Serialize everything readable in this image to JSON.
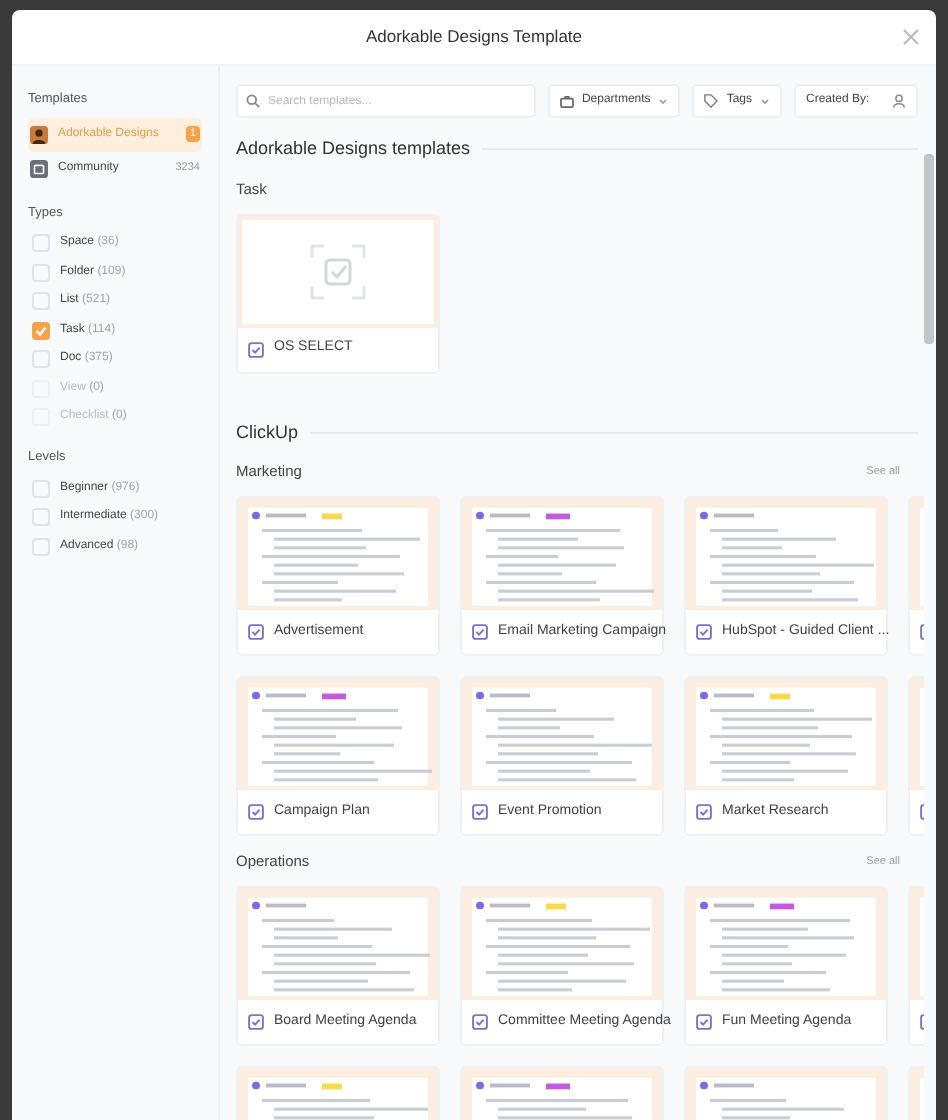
{
  "window": {
    "title": "Adorkable Designs Template"
  },
  "sidebar": {
    "templates_heading": "Templates",
    "sources": [
      {
        "label": "Adorkable Designs",
        "count": "1",
        "selected": true,
        "kind": "avatar"
      },
      {
        "label": "Community",
        "count": "3234",
        "selected": false,
        "kind": "store"
      }
    ],
    "types_heading": "Types",
    "types": [
      {
        "label": "Space",
        "count": "(36)",
        "checked": false,
        "disabled": false
      },
      {
        "label": "Folder",
        "count": "(109)",
        "checked": false,
        "disabled": false
      },
      {
        "label": "List",
        "count": "(521)",
        "checked": false,
        "disabled": false
      },
      {
        "label": "Task",
        "count": "(114)",
        "checked": true,
        "disabled": false
      },
      {
        "label": "Doc",
        "count": "(375)",
        "checked": false,
        "disabled": false
      },
      {
        "label": "View",
        "count": "(0)",
        "checked": false,
        "disabled": true
      },
      {
        "label": "Checklist",
        "count": "(0)",
        "checked": false,
        "disabled": true
      }
    ],
    "levels_heading": "Levels",
    "levels": [
      {
        "label": "Beginner",
        "count": "(976)",
        "checked": false
      },
      {
        "label": "Intermediate",
        "count": "(300)",
        "checked": false
      },
      {
        "label": "Advanced",
        "count": "(98)",
        "checked": false
      }
    ]
  },
  "toolbar": {
    "search": {
      "placeholder": "Search templates..."
    },
    "departments": "Departments",
    "tags": "Tags",
    "created_by": "Created By:"
  },
  "groups": [
    {
      "title": "Adorkable Designs templates",
      "sections": [
        {
          "title": "Task",
          "cards": [
            {
              "title": "OS SELECT",
              "kind": "placeholder"
            }
          ]
        }
      ]
    },
    {
      "title": "ClickUp",
      "sections": [
        {
          "title": "Marketing",
          "see_all": "See all",
          "cards": [
            {
              "title": "Advertisement",
              "kind": "preview"
            },
            {
              "title": "Email Marketing Campaign",
              "kind": "preview"
            },
            {
              "title": "HubSpot - Guided Client ...",
              "kind": "preview"
            },
            {
              "kind": "preview"
            },
            {
              "title": "Campaign Plan",
              "kind": "preview"
            },
            {
              "title": "Event Promotion",
              "kind": "preview"
            },
            {
              "title": "Market Research",
              "kind": "preview"
            },
            {
              "kind": "preview"
            }
          ]
        },
        {
          "title": "Operations",
          "see_all": "See all",
          "cards": [
            {
              "title": "Board Meeting Agenda",
              "kind": "preview"
            },
            {
              "title": "Committee Meeting Agenda",
              "kind": "preview"
            },
            {
              "title": "Fun Meeting Agenda",
              "kind": "preview"
            },
            {
              "kind": "preview"
            },
            {
              "kind": "preview"
            },
            {
              "kind": "preview"
            },
            {
              "kind": "preview"
            },
            {
              "kind": "preview"
            }
          ]
        }
      ]
    }
  ]
}
